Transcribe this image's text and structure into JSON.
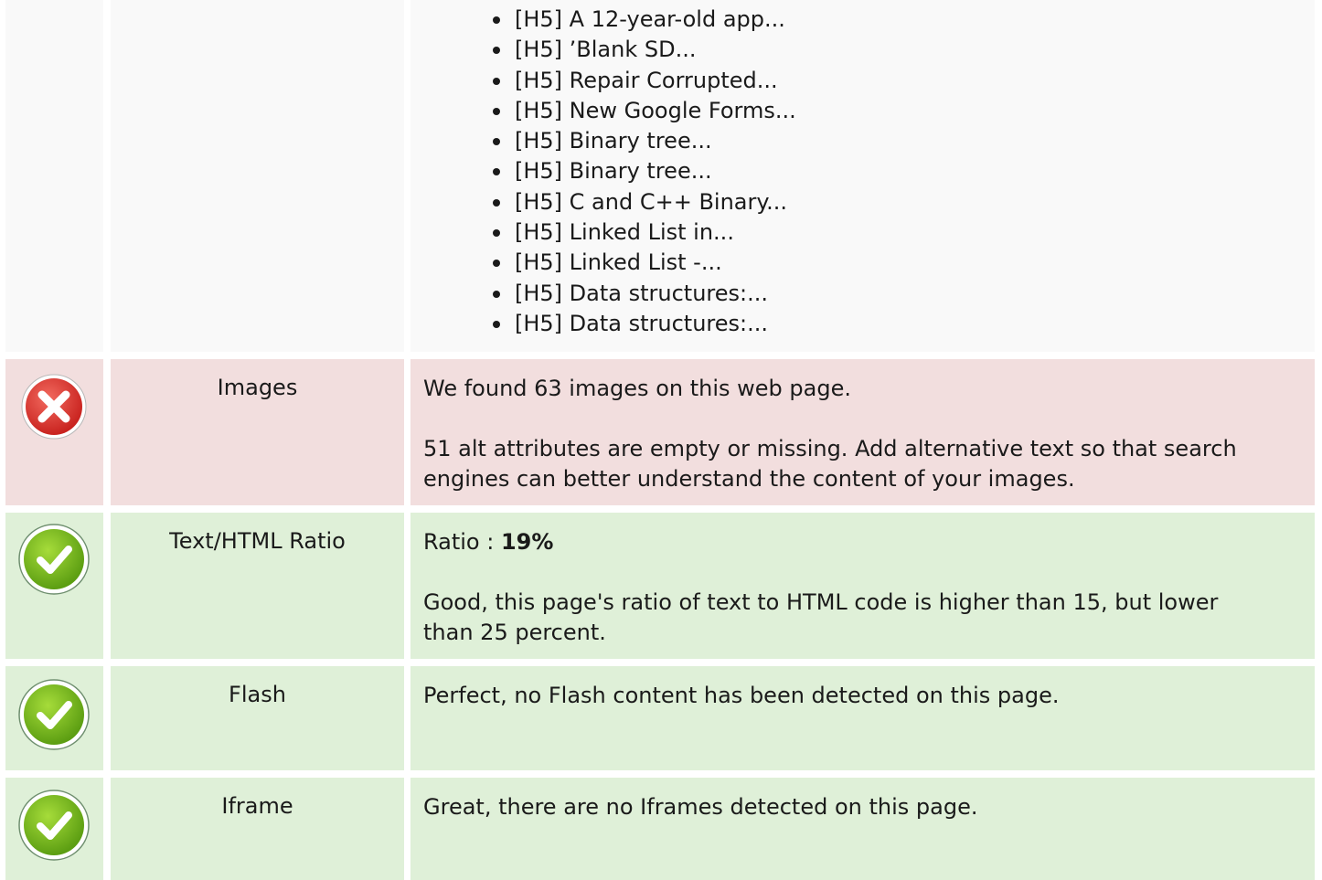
{
  "headings": {
    "items": [
      "[H5] A 12-year-old app...",
      "[H5] ’Blank SD...",
      "[H5] Repair Corrupted...",
      "[H5] New Google Forms...",
      "[H5] Binary tree...",
      "[H5] Binary tree...",
      "[H5] C and C++ Binary...",
      "[H5] Linked List in...",
      "[H5] Linked List -...",
      "[H5] Data structures:...",
      "[H5] Data structures:..."
    ]
  },
  "images": {
    "label": "Images",
    "status_icon": "error-x-icon",
    "line1": "We found 63 images on this web page.",
    "line2": "51 alt attributes are empty or missing. Add alternative text so that search engines can better understand the content of your images."
  },
  "ratio": {
    "label": "Text/HTML Ratio",
    "status_icon": "check-icon",
    "prefix": "Ratio : ",
    "value": "19%",
    "line2": "Good, this page's ratio of text to HTML code is higher than 15, but lower than 25 percent."
  },
  "flash": {
    "label": "Flash",
    "status_icon": "check-icon",
    "line1": "Perfect, no Flash content has been detected on this page."
  },
  "iframe": {
    "label": "Iframe",
    "status_icon": "check-icon",
    "line1": "Great, there are no Iframes detected on this page."
  },
  "colors": {
    "neutral_bg": "#f9f9f9",
    "bad_bg": "#f2dede",
    "good_bg": "#dff0d8",
    "error_red": "#d9322f",
    "success_green": "#7dbb1e"
  }
}
